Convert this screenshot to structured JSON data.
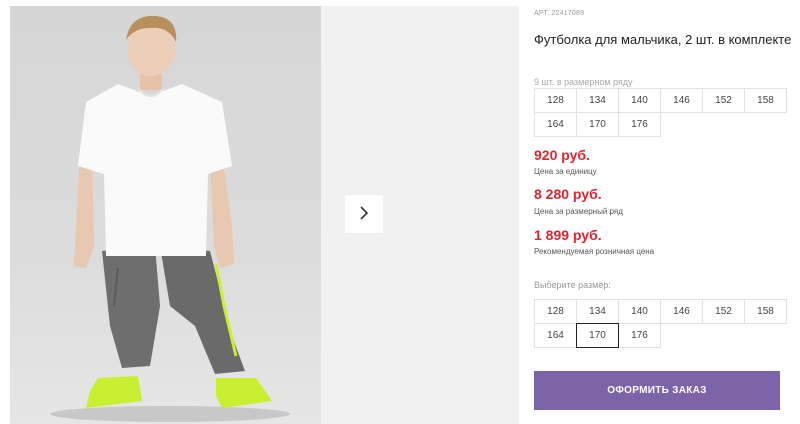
{
  "product": {
    "article": "АРТ. 22417089",
    "title": "Футболка для мальчика, 2 шт. в комплекте",
    "grid_caption": "9 шт. в размерном ряду",
    "sizes": [
      "128",
      "134",
      "140",
      "146",
      "152",
      "158",
      "164",
      "170",
      "176"
    ],
    "prices": {
      "unit_price": "920 руб.",
      "unit_label": "Цена за единицу",
      "set_price": "8 280 руб.",
      "set_label": "Цена за размерный ряд",
      "retail_price": "1 899 руб.",
      "retail_label": "Рекомендуемая розничная цена"
    },
    "choose_label": "Выберите размер:",
    "selected_size": "170",
    "order_button": "ОФОРМИТЬ ЗАКАЗ"
  },
  "gallery": {
    "next_icon": "chevron-right-icon"
  },
  "colors": {
    "price": "#e0242f",
    "button": "#7b64a8"
  }
}
